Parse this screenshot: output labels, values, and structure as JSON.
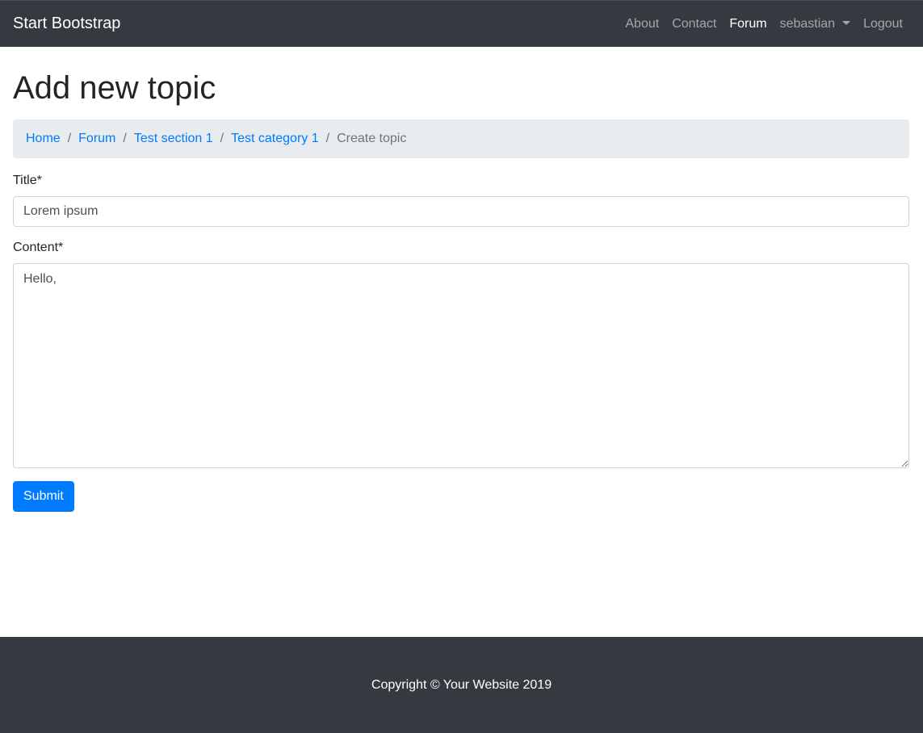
{
  "navbar": {
    "brand": "Start Bootstrap",
    "links": [
      {
        "label": "About",
        "active": false
      },
      {
        "label": "Contact",
        "active": false
      },
      {
        "label": "Forum",
        "active": true
      },
      {
        "label": "sebastian",
        "active": false,
        "dropdown": true
      },
      {
        "label": "Logout",
        "active": false
      }
    ]
  },
  "page": {
    "title": "Add new topic"
  },
  "breadcrumb": {
    "items": [
      "Home",
      "Forum",
      "Test section 1",
      "Test category 1"
    ],
    "active": "Create topic",
    "separator": "/"
  },
  "form": {
    "title_label": "Title*",
    "title_value": "Lorem ipsum",
    "content_label": "Content*",
    "content_value": "Hello,",
    "submit_label": "Submit"
  },
  "footer": {
    "text": "Copyright © Your Website 2019"
  },
  "colors": {
    "navbar_bg": "#343a40",
    "link": "#007bff",
    "primary": "#007bff",
    "breadcrumb_bg": "#e9ecef"
  }
}
